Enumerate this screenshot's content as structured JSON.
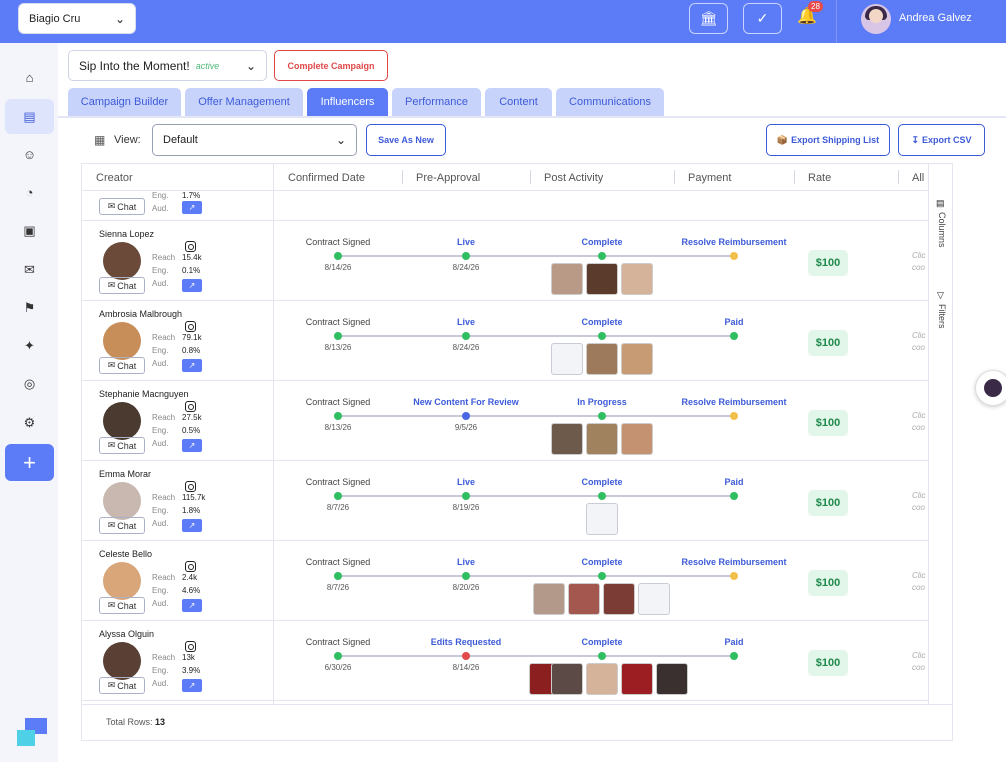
{
  "topbar": {
    "brand": "Biagio Cru",
    "notification_count": "28",
    "user_name": "Andrea Galvez"
  },
  "campaign": {
    "name": "Sip Into the Moment!",
    "status": "active",
    "complete_label": "Complete Campaign"
  },
  "tabs": [
    {
      "label": "Campaign Builder"
    },
    {
      "label": "Offer Management"
    },
    {
      "label": "Influencers"
    },
    {
      "label": "Performance"
    },
    {
      "label": "Content"
    },
    {
      "label": "Communications"
    }
  ],
  "toolbar": {
    "view_label": "View:",
    "view_value": "Default",
    "save_as_new": "Save As New",
    "export_shipping": "Export Shipping List",
    "export_csv": "Export CSV"
  },
  "grid": {
    "columns": [
      "Creator",
      "Confirmed Date",
      "Pre-Approval",
      "Post Activity",
      "Payment",
      "Rate",
      "All"
    ],
    "side_columns": "Columns",
    "side_filters": "Filters",
    "total_label": "Total Rows:",
    "total_value": "13",
    "chat_label": "Chat",
    "metric_labels": {
      "reach": "Reach",
      "eng": "Eng.",
      "aud": "Aud."
    },
    "click_text": "Clic",
    "click_text2": "coo",
    "partial_row": {
      "eng": "1.7%"
    },
    "rows": [
      {
        "name": "Sienna Lopez",
        "reach": "15.4k",
        "eng": "0.1%",
        "s1": "Contract Signed",
        "s2": "Live",
        "s3": "Complete",
        "s4": "Resolve Reimbursement",
        "d1": "8/14/26",
        "d2": "8/24/26",
        "rate": "$100"
      },
      {
        "name": "Ambrosia Malbrough",
        "reach": "79.1k",
        "eng": "0.8%",
        "s1": "Contract Signed",
        "s2": "Live",
        "s3": "Complete",
        "s4": "Paid",
        "d1": "8/13/26",
        "d2": "8/24/26",
        "rate": "$100"
      },
      {
        "name": "Stephanie Macnguyen",
        "reach": "27.5k",
        "eng": "0.5%",
        "s1": "Contract Signed",
        "s2": "New Content For Review",
        "s3": "In Progress",
        "s4": "Resolve Reimbursement",
        "d1": "8/13/26",
        "d2": "9/5/26",
        "rate": "$100"
      },
      {
        "name": "Emma Morar",
        "reach": "115.7k",
        "eng": "1.8%",
        "s1": "Contract Signed",
        "s2": "Live",
        "s3": "Complete",
        "s4": "Paid",
        "d1": "8/7/26",
        "d2": "8/19/26",
        "rate": "$100"
      },
      {
        "name": "Celeste Bello",
        "reach": "2.4k",
        "eng": "4.6%",
        "s1": "Contract Signed",
        "s2": "Live",
        "s3": "Complete",
        "s4": "Resolve Reimbursement",
        "d1": "8/7/26",
        "d2": "8/20/26",
        "rate": "$100"
      },
      {
        "name": "Alyssa Olguin",
        "reach": "13k",
        "eng": "3.9%",
        "s1": "Contract Signed",
        "s2": "Edits Requested",
        "s3": "Complete",
        "s4": "Paid",
        "d1": "6/30/26",
        "d2": "8/14/26",
        "rate": "$100"
      }
    ]
  }
}
